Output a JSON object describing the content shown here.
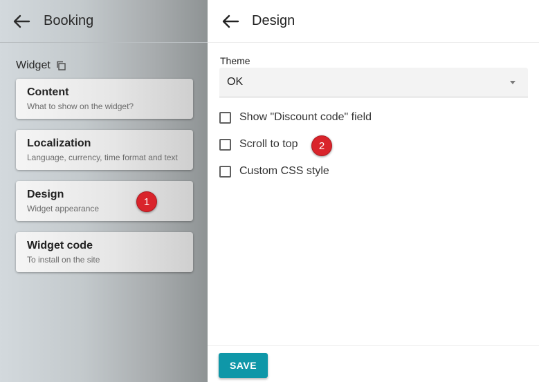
{
  "left": {
    "title": "Booking",
    "section_label": "Widget",
    "items": [
      {
        "title": "Content",
        "subtitle": "What to show on the widget?"
      },
      {
        "title": "Localization",
        "subtitle": "Language, currency, time format and text"
      },
      {
        "title": "Design",
        "subtitle": "Widget appearance"
      },
      {
        "title": "Widget code",
        "subtitle": "To install on the site"
      }
    ]
  },
  "right": {
    "title": "Design",
    "theme": {
      "label": "Theme",
      "value": "OK"
    },
    "options": [
      {
        "label": "Show \"Discount code\" field",
        "checked": false
      },
      {
        "label": "Scroll to top",
        "checked": false
      },
      {
        "label": "Custom CSS style",
        "checked": false
      }
    ],
    "save_label": "SAVE"
  },
  "annotations": {
    "first": "1",
    "second": "2"
  },
  "colors": {
    "accent": "#0f97a8",
    "badge": "#d9242b"
  }
}
